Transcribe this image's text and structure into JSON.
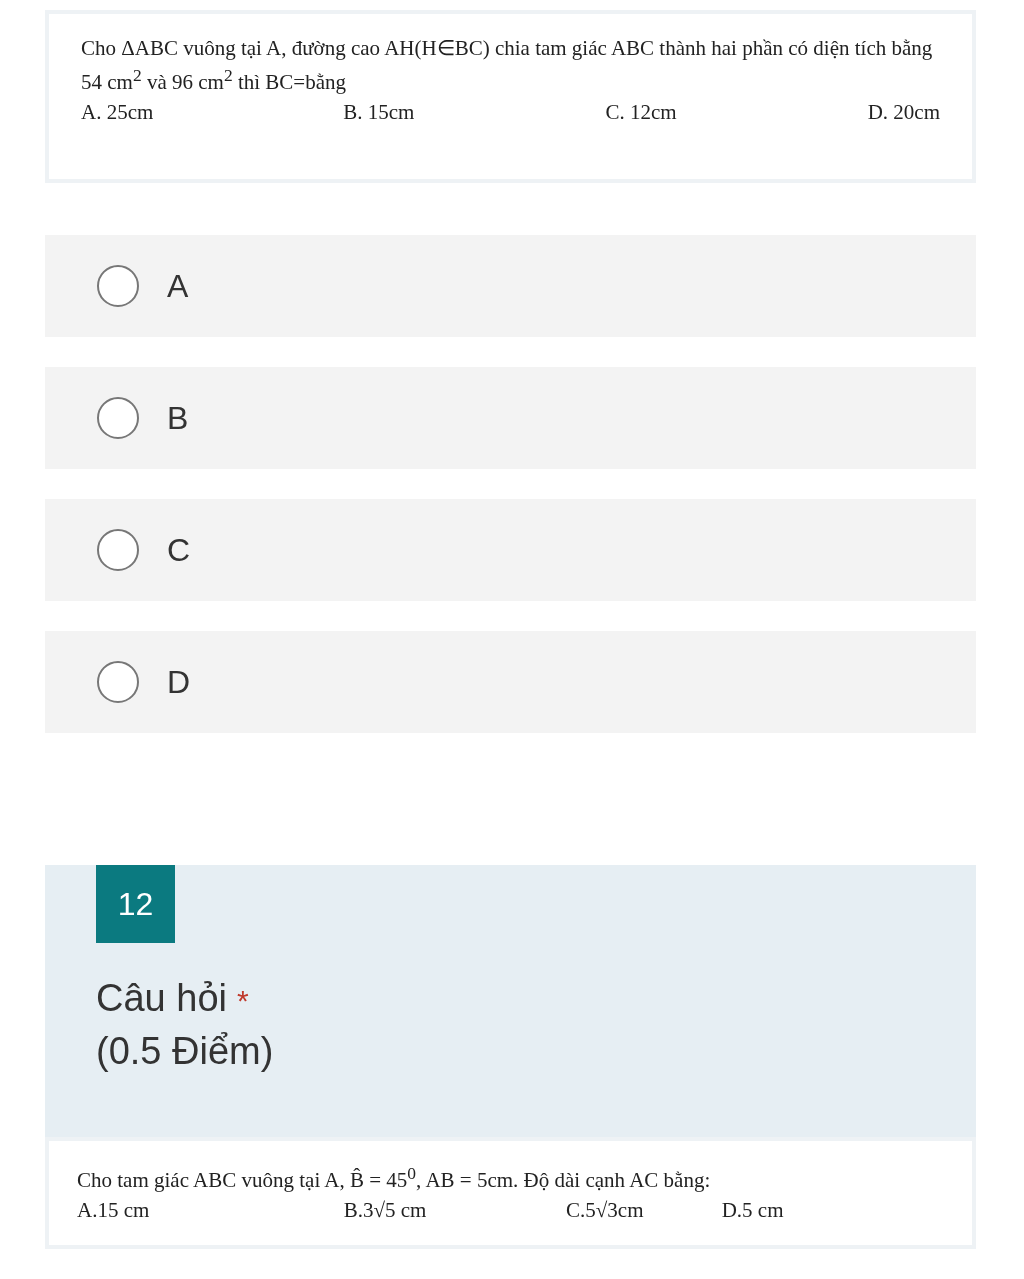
{
  "question_image": {
    "lines": [
      "Cho ΔABC vuông tại A, đường cao AH(H∈BC) chia tam giác ABC thành hai phần có diện tích bằng 54 cm$^{2}$ và 96 cm$^{2}$ thì BC=bằng"
    ],
    "choices": [
      "A. 25cm",
      "B.  15cm",
      "C. 12cm",
      "D. 20cm"
    ]
  },
  "options": [
    {
      "label": "A",
      "selected": false
    },
    {
      "label": "B",
      "selected": false
    },
    {
      "label": "C",
      "selected": false
    },
    {
      "label": "D",
      "selected": false
    }
  ],
  "next_question": {
    "number": "12",
    "title": "Câu hỏi",
    "required_mark": "*",
    "points": "(0.5 Điểm)",
    "image": {
      "lines": [
        "Cho tam giác ABC vuông tại A, B̂ = 45$^{0}$, AB = 5cm. Độ dài cạnh AC bằng:"
      ],
      "choices": [
        "A.15 cm",
        "B.3√5 cm",
        "C.5√3cm",
        "D.5 cm"
      ]
    }
  }
}
